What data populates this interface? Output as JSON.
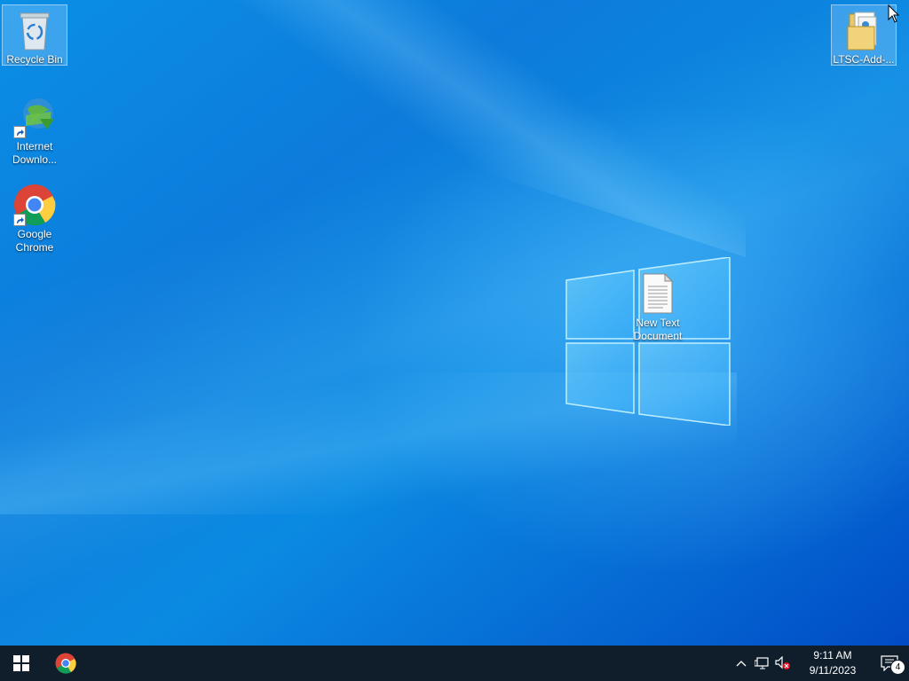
{
  "desktop": {
    "icons": [
      {
        "label": "Recycle Bin"
      },
      {
        "label": "LTSC-Add-..."
      },
      {
        "label": "Internet Downlo..."
      },
      {
        "label": "Google Chrome"
      },
      {
        "label": "New Text Document"
      }
    ]
  },
  "taskbar": {
    "pinned": [
      {
        "icon": "windows-start-icon"
      },
      {
        "icon": "chrome-icon"
      }
    ],
    "tray": {
      "time": "9:11 AM",
      "date": "9/11/2023",
      "notification_count": "4"
    }
  },
  "colors": {
    "taskbar": "#101e2b",
    "accent": "#0078d7"
  }
}
